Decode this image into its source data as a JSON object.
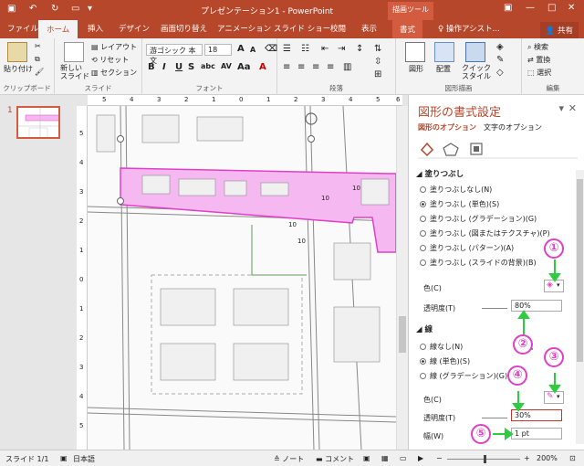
{
  "app": {
    "title": "プレゼンテーション1 - PowerPoint",
    "context_tool": "描画ツール",
    "share": "共有",
    "tell_me": "操作アシスト..."
  },
  "tabs": [
    "ファイル",
    "ホーム",
    "挿入",
    "デザイン",
    "画面切り替え",
    "アニメーション",
    "スライド ショー",
    "校閲",
    "表示",
    "書式"
  ],
  "ribbon": {
    "clipboard": {
      "paste": "貼り付け",
      "label": "クリップボード"
    },
    "slides": {
      "new_slide": "新しい\nスライド",
      "layout": "レイアウト",
      "reset": "リセット",
      "section": "セクション",
      "label": "スライド"
    },
    "font": {
      "name": "游ゴシック 本文",
      "size": "18",
      "label": "フォント"
    },
    "paragraph": {
      "label": "段落"
    },
    "drawing": {
      "shapes": "図形",
      "arrange": "配置",
      "quick_styles": "クイック\nスタイル",
      "label": "図形描画"
    },
    "editing": {
      "find": "検索",
      "replace": "置換",
      "select": "選択",
      "label": "編集"
    }
  },
  "thumbnail": {
    "number": "1"
  },
  "rulers": {
    "top_ticks": [
      "5",
      "4",
      "3",
      "2",
      "1",
      "0",
      "1",
      "2",
      "3",
      "4",
      "5",
      "6"
    ],
    "left_ticks": [
      "5",
      "4",
      "3",
      "2",
      "1",
      "0",
      "1",
      "2",
      "3",
      "4",
      "5"
    ]
  },
  "map_labels": [
    "10",
    "10",
    "10",
    "10"
  ],
  "pane": {
    "title": "図形の書式設定",
    "tab_shape": "図形のオプション",
    "tab_text": "文字のオプション",
    "fill_header": "塗りつぶし",
    "fill_options": [
      "塗りつぶしなし(N)",
      "塗りつぶし (単色)(S)",
      "塗りつぶし (グラデーション)(G)",
      "塗りつぶし (図またはテクスチャ)(P)",
      "塗りつぶし (パターン)(A)",
      "塗りつぶし (スライドの背景)(B)"
    ],
    "fill_color_label": "色(C)",
    "fill_transparency_label": "透明度(T)",
    "fill_transparency": "80%",
    "line_header": "線",
    "line_options": [
      "線なし(N)",
      "線 (単色)(S)",
      "線 (グラデーション)(G)"
    ],
    "line_color_label": "色(C)",
    "line_transparency_label": "透明度(T)",
    "line_transparency": "30%",
    "width_label": "幅(W)",
    "width_value": "1 pt",
    "callouts": [
      "①",
      "②",
      "③",
      "④",
      "⑤"
    ]
  },
  "status": {
    "slide": "スライド 1/1",
    "language": "日本語",
    "notes": "ノート",
    "comments": "コメント",
    "zoom": "200%"
  },
  "colors": {
    "accent": "#b7472a",
    "highlight_fill": "#f5b8f0",
    "highlight_stroke": "#e040c8",
    "callout": "#e040c8",
    "arrow": "#2ecc40"
  }
}
